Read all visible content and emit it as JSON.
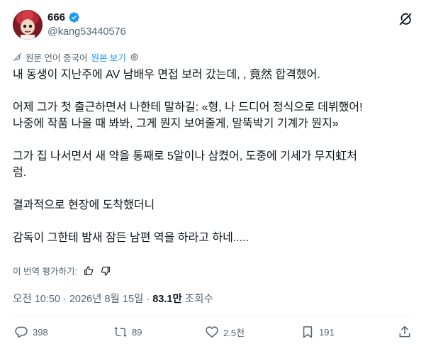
{
  "user": {
    "display_name": "666",
    "handle": "@kang53440576"
  },
  "translation_bar": {
    "label": "원문 언어 중국어",
    "show_original": "원본 보기"
  },
  "tweet": {
    "paragraphs": [
      "내 동생이 지난주에 AV 남배우 면접 보러 갔는데, , 竟然 합격했어.",
      "어제 그가 첫 출근하면서 나한테 말하길: «형, 나 드디어 정식으로 데뷔했어!\n나중에 작품 나올 때 봐봐, 그게 뭔지 보여줄게, 말뚝박기 기계가 뭔지»",
      "그가 집 나서면서 새 약을 통째로 5알이나 삼켰어, 도중에 기세가 무지虹처\n럼.",
      "결과적으로 현장에 도착했더니",
      "감독이 그한테 밤새 잠든 남편 역을 하라고 하네....."
    ]
  },
  "rate_translation": "이 번역 평가하기:",
  "meta": {
    "time": "오전 10:50",
    "sep1": "·",
    "date": "2026년 8월 15일",
    "sep2": "·",
    "views": "83.1만",
    "views_label": "조회수"
  },
  "actions": {
    "replies": "398",
    "reposts": "89",
    "likes": "2.5천",
    "bookmarks": "191"
  },
  "colors": {
    "text": "#0f1419",
    "secondary": "#536471",
    "accent": "#1d9bf0"
  }
}
